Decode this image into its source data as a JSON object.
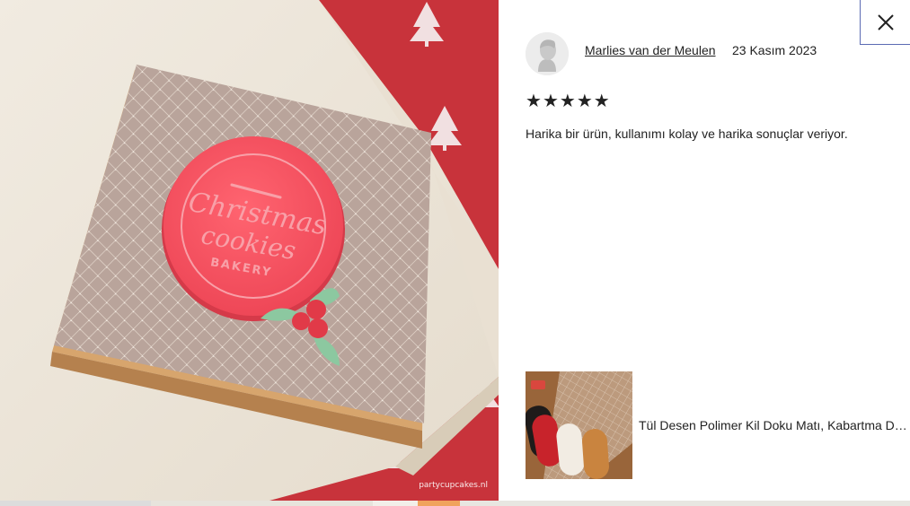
{
  "photo": {
    "watermark": "partycupcakes.nl",
    "stamp_line1": "Christmas",
    "stamp_line2": "cookies",
    "stamp_line3": "BAKERY"
  },
  "review": {
    "reviewer_name": "Marlies van der Meulen",
    "date": "23 Kasım 2023",
    "rating": 5,
    "stars": [
      "★",
      "★",
      "★",
      "★",
      "★"
    ],
    "text": "Harika bir ürün, kullanımı kolay ve harika sonuçlar veriyor."
  },
  "product": {
    "title": "Tül Desen Polimer Kil Doku Matı, Kabartma Dokusu, Polimer Kil Dokulu Levha"
  },
  "icons": {
    "close": "close-icon",
    "avatar": "user-avatar-icon"
  },
  "colors": {
    "accent_border": "#5b6bb3",
    "text": "#222222"
  }
}
